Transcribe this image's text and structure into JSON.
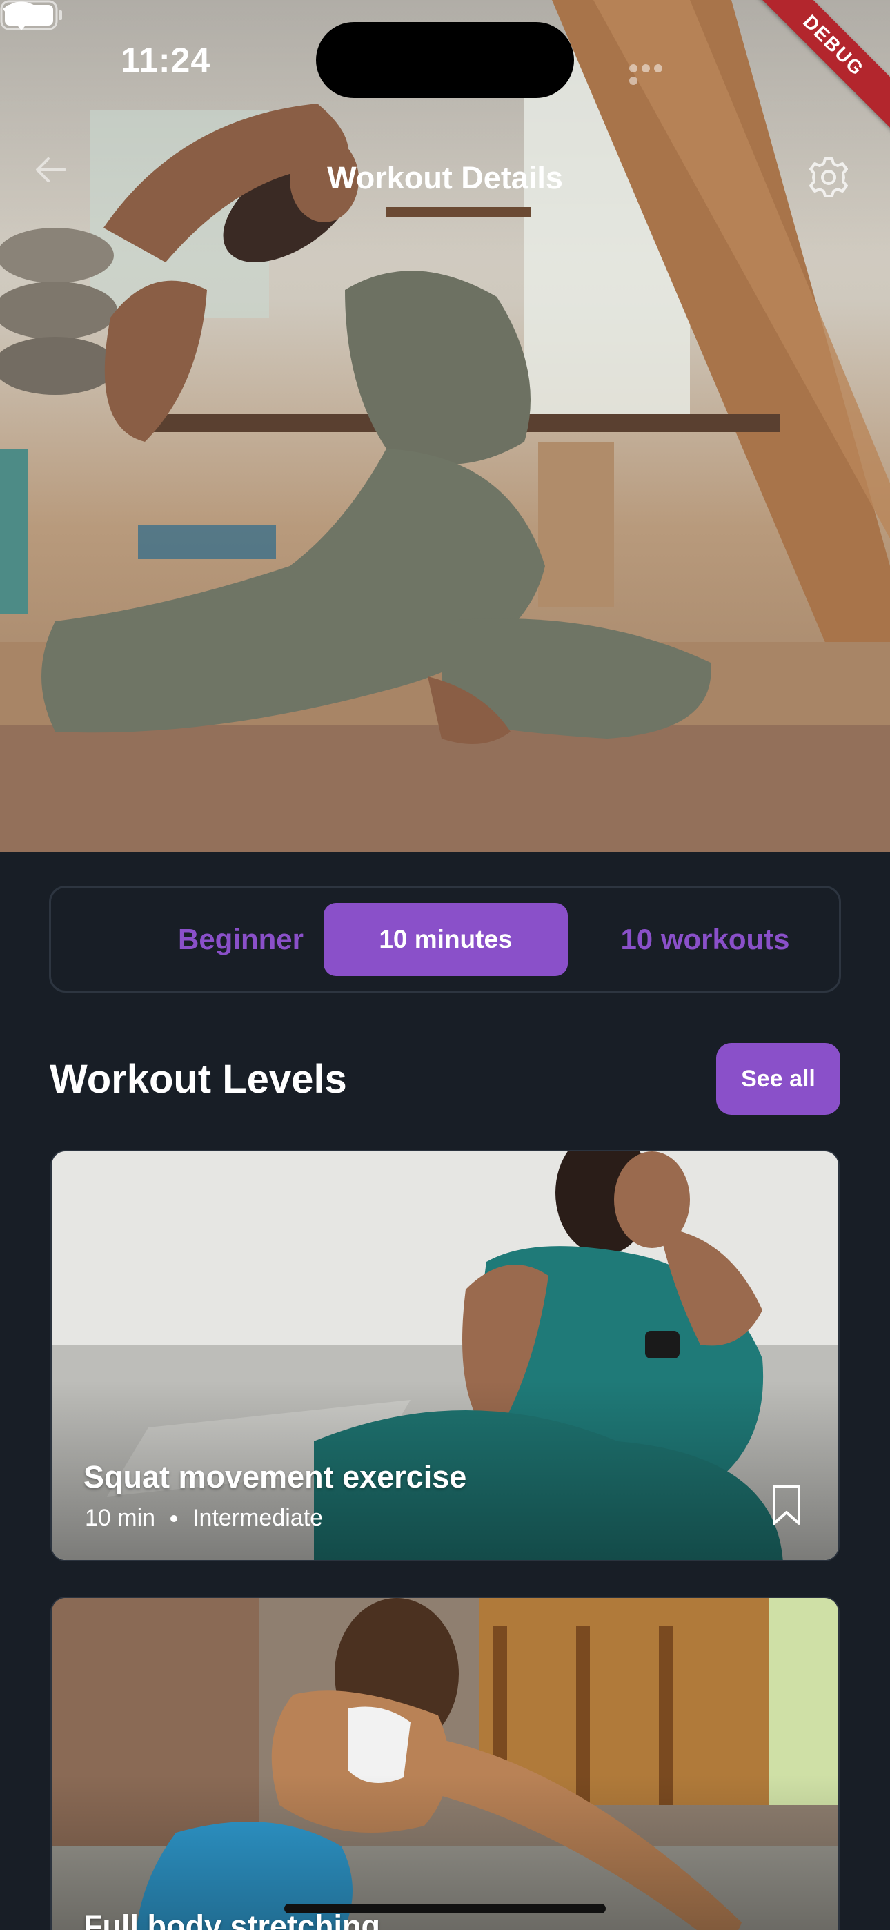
{
  "status_bar": {
    "time": "11:24",
    "debug_label": "DEBUG"
  },
  "app_bar": {
    "title": "Workout Details",
    "back_icon": "arrow-left-icon",
    "settings_icon": "gear-icon"
  },
  "segments": [
    {
      "label": "Beginner",
      "selected": false
    },
    {
      "label": "10 minutes",
      "selected": true
    },
    {
      "label": "10 workouts",
      "selected": false
    }
  ],
  "section": {
    "title": "Workout Levels",
    "see_all_label": "See all"
  },
  "cards": [
    {
      "title": "Squat movement exercise",
      "duration": "10 min",
      "level": "Intermediate",
      "bookmark_icon": "bookmark-icon"
    },
    {
      "title": "Full body stretching"
    }
  ],
  "colors": {
    "accent": "#8a50c9",
    "background": "#181e26",
    "debug_ribbon": "#b3262d"
  }
}
